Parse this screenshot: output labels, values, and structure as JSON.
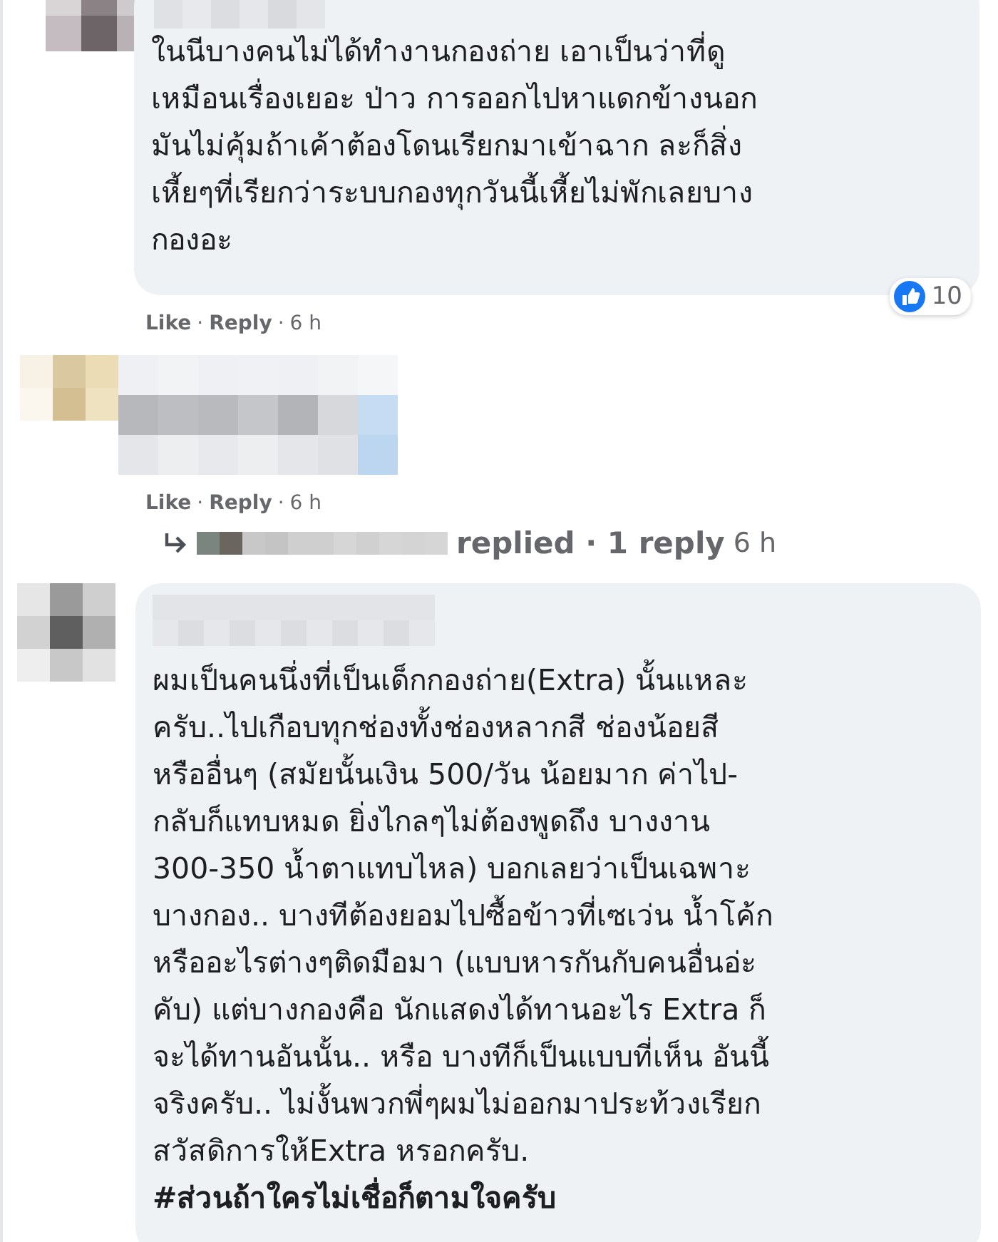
{
  "comments": [
    {
      "kind": "text",
      "text": "ในนีบางคนไม่ได้ทำงานกองถ่าย เอาเป็นว่าที่ดู\nเหมือนเรื่องเยอะ ป่าว การออกไปหาแดกข้างนอก\nมันไม่คุ้มถ้าเค้าต้องโดนเรียกมาเข้าฉาก ละก็สิ่ง\nเหี้ยๆที่เรียกว่าระบบกองทุกวันนี้เหี้ยไม่พักเลยบาง\nกองอะ",
      "reactions": "10",
      "actions": [
        "Like",
        "Reply"
      ],
      "separator": "·",
      "time": "6 h"
    },
    {
      "kind": "blurred",
      "actions": [
        "Like",
        "Reply"
      ],
      "separator": "·",
      "time": "6 h",
      "replies": {
        "label": "replied · 1 reply",
        "time": "6 h"
      }
    },
    {
      "kind": "text",
      "text": "ผมเป็นคนนึ่งที่เป็นเด็กกองถ่าย(Extra) นั้นแหละ\nครับ..ไปเกือบทุกช่องทั้งช่องหลากสี ช่องน้อยสี\nหรืออื่นๆ (สมัยนั้นเงิน 500/วัน น้อยมาก ค่าไป-\nกลับก็แทบหมด ยิ่งไกลๆไม่ต้องพูดถึง บางงาน\n300-350 น้ำตาแทบไหล) บอกเลยว่าเป็นเฉพาะ\nบางกอง.. บางทีต้องยอมไปซื้อข้าวที่เซเว่น น้ำโค้ก\nหรืออะไรต่างๆติดมือมา (แบบหารกันกับคนอื่นอ่ะ\nคับ) แต่บางกองคือ นักแสดงได้ทานอะไร Extra ก็\nจะได้ทานอันนั้น.. หรือ บางทีก็เป็นแบบที่เห็น อันนี้\nจริงครับ.. ไม่งั้นพวกพี่ๆผมไม่ออกมาประท้วงเรียก\nสวัสดิการให้Extra หรอกครับ.",
      "hashtag": "#ส่วนถ้าใครไม่เชื่อก็ตามใจครับ"
    }
  ]
}
